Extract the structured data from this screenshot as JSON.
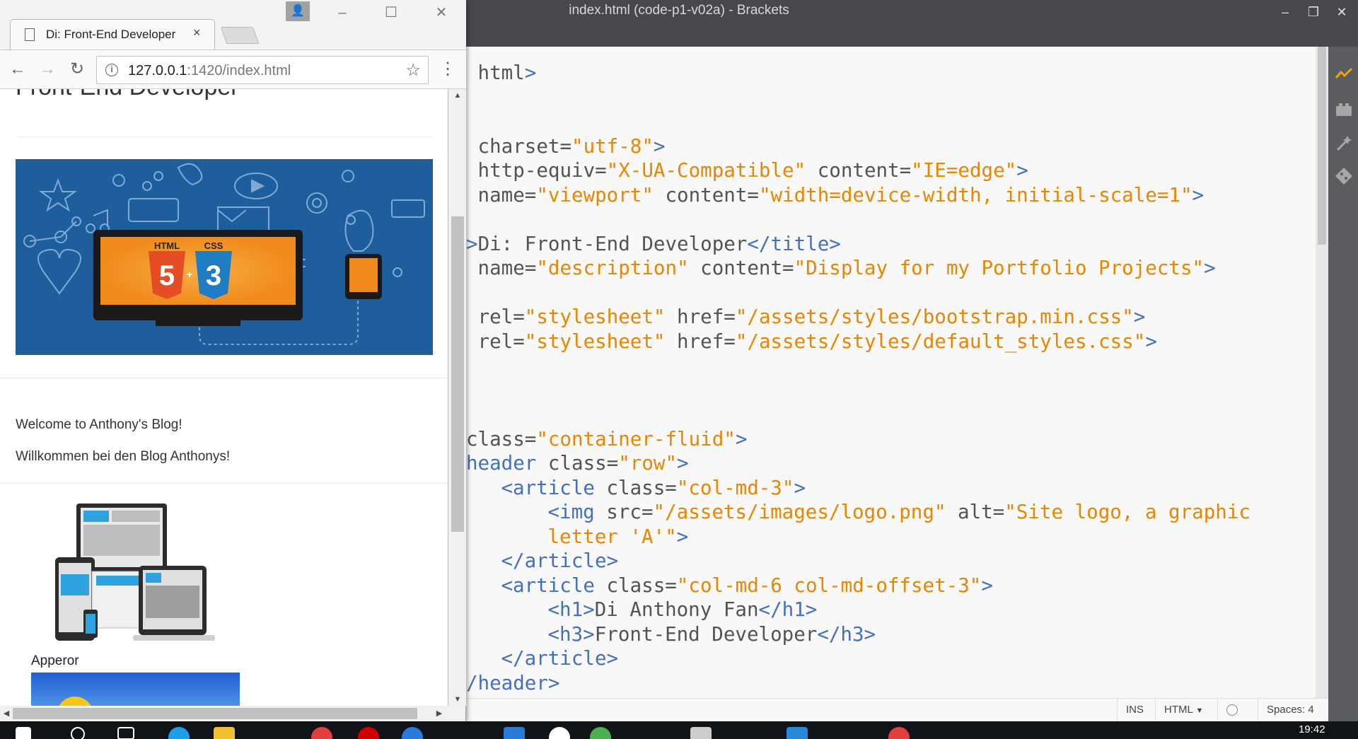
{
  "brackets": {
    "window_title": "index.html (code-p1-v02a) - Brackets",
    "code_lines": [
      {
        "indent": 0,
        "parts": [
          {
            "c": "at",
            "t": " html"
          },
          {
            "c": "tg",
            "t": ">"
          }
        ]
      },
      {
        "indent": 0,
        "parts": []
      },
      {
        "indent": 0,
        "parts": []
      },
      {
        "indent": 0,
        "parts": [
          {
            "c": "at",
            "t": " charset="
          },
          {
            "c": "vl",
            "t": "\"utf-8\""
          },
          {
            "c": "tg",
            "t": ">"
          }
        ]
      },
      {
        "indent": 0,
        "parts": [
          {
            "c": "at",
            "t": " http-equiv="
          },
          {
            "c": "vl",
            "t": "\"X-UA-Compatible\""
          },
          {
            "c": "at",
            "t": " content="
          },
          {
            "c": "vl",
            "t": "\"IE=edge\""
          },
          {
            "c": "tg",
            "t": ">"
          }
        ]
      },
      {
        "indent": 0,
        "parts": [
          {
            "c": "at",
            "t": " name="
          },
          {
            "c": "vl",
            "t": "\"viewport\""
          },
          {
            "c": "at",
            "t": " content="
          },
          {
            "c": "vl",
            "t": "\"width=device-width, initial-scale=1\""
          },
          {
            "c": "tg",
            "t": ">"
          }
        ]
      },
      {
        "indent": 0,
        "parts": []
      },
      {
        "indent": 0,
        "parts": [
          {
            "c": "tg",
            "t": ">"
          },
          {
            "c": "at",
            "t": "Di: Front-End Developer"
          },
          {
            "c": "tg",
            "t": "</title>"
          }
        ]
      },
      {
        "indent": 0,
        "parts": [
          {
            "c": "at",
            "t": " name="
          },
          {
            "c": "vl",
            "t": "\"description\""
          },
          {
            "c": "at",
            "t": " content="
          },
          {
            "c": "vl",
            "t": "\"Display for my Portfolio Projects\""
          },
          {
            "c": "tg",
            "t": ">"
          }
        ]
      },
      {
        "indent": 0,
        "parts": []
      },
      {
        "indent": 0,
        "parts": [
          {
            "c": "at",
            "t": " rel="
          },
          {
            "c": "vl",
            "t": "\"stylesheet\""
          },
          {
            "c": "at",
            "t": " href="
          },
          {
            "c": "vl",
            "t": "\"/assets/styles/bootstrap.min.css\""
          },
          {
            "c": "tg",
            "t": ">"
          }
        ]
      },
      {
        "indent": 0,
        "parts": [
          {
            "c": "at",
            "t": " rel="
          },
          {
            "c": "vl",
            "t": "\"stylesheet\""
          },
          {
            "c": "at",
            "t": " href="
          },
          {
            "c": "vl",
            "t": "\"/assets/styles/default_styles.css\""
          },
          {
            "c": "tg",
            "t": ">"
          }
        ]
      },
      {
        "indent": 0,
        "parts": []
      },
      {
        "indent": 0,
        "parts": []
      },
      {
        "indent": 0,
        "parts": []
      },
      {
        "indent": 0,
        "parts": [
          {
            "c": "at",
            "t": "class="
          },
          {
            "c": "vl",
            "t": "\"container-fluid\""
          },
          {
            "c": "tg",
            "t": ">"
          }
        ]
      },
      {
        "indent": 0,
        "parts": [
          {
            "c": "tg",
            "t": "header"
          },
          {
            "c": "at",
            "t": " class="
          },
          {
            "c": "vl",
            "t": "\"row\""
          },
          {
            "c": "tg",
            "t": ">"
          }
        ]
      },
      {
        "indent": 3,
        "parts": [
          {
            "c": "tg",
            "t": "<article"
          },
          {
            "c": "at",
            "t": " class="
          },
          {
            "c": "vl",
            "t": "\"col-md-3\""
          },
          {
            "c": "tg",
            "t": ">"
          }
        ]
      },
      {
        "indent": 7,
        "parts": [
          {
            "c": "tg",
            "t": "<img"
          },
          {
            "c": "at",
            "t": " src="
          },
          {
            "c": "vl",
            "t": "\"/assets/images/logo.png\""
          },
          {
            "c": "at",
            "t": " alt="
          },
          {
            "c": "vl",
            "t": "\"Site logo, a graphic"
          }
        ]
      },
      {
        "indent": 7,
        "parts": [
          {
            "c": "vl",
            "t": "letter 'A'\""
          },
          {
            "c": "tg",
            "t": ">"
          }
        ]
      },
      {
        "indent": 3,
        "parts": [
          {
            "c": "tg",
            "t": "</article>"
          }
        ]
      },
      {
        "indent": 3,
        "parts": [
          {
            "c": "tg",
            "t": "<article"
          },
          {
            "c": "at",
            "t": " class="
          },
          {
            "c": "vl",
            "t": "\"col-md-6 col-md-offset-3\""
          },
          {
            "c": "tg",
            "t": ">"
          }
        ]
      },
      {
        "indent": 7,
        "parts": [
          {
            "c": "tg",
            "t": "<h1>"
          },
          {
            "c": "at",
            "t": "Di Anthony Fan"
          },
          {
            "c": "tg",
            "t": "</h1>"
          }
        ]
      },
      {
        "indent": 7,
        "parts": [
          {
            "c": "tg",
            "t": "<h3>"
          },
          {
            "c": "at",
            "t": "Front-End Developer"
          },
          {
            "c": "tg",
            "t": "</h3>"
          }
        ]
      },
      {
        "indent": 3,
        "parts": [
          {
            "c": "tg",
            "t": "</article>"
          }
        ]
      },
      {
        "indent": 0,
        "parts": [
          {
            "c": "tg",
            "t": "/header>"
          }
        ]
      }
    ],
    "status": {
      "mode": "INS",
      "language": "HTML",
      "spaces": "Spaces: 4"
    }
  },
  "browser": {
    "tab_title": "Di: Front-End Developer",
    "tab_close": "×",
    "url_host": "127.0.0.1",
    "url_rest": ":1420/index.html",
    "page": {
      "subtitle": "Front-End Developer",
      "hero_labels": {
        "html": "HTML",
        "css": "CSS"
      },
      "welcome_en": "Welcome to Anthony's Blog!",
      "welcome_de": "Willkommen bei den Blog Anthonys!",
      "project_caption": "Apperor"
    }
  },
  "taskbar": {
    "clock": "19:42"
  },
  "colors": {
    "tag": "#446fbd",
    "attribute": "#535353",
    "value": "#e88501",
    "editor_bg": "#f8f8f8",
    "chrome_frame": "#47484b"
  },
  "icons": [
    "live-preview-icon",
    "extension-manager-icon",
    "wand-icon",
    "git-icon",
    "user-icon",
    "back-arrow-icon",
    "forward-arrow-icon",
    "reload-icon",
    "info-icon",
    "star-icon",
    "menu-dots-icon"
  ]
}
